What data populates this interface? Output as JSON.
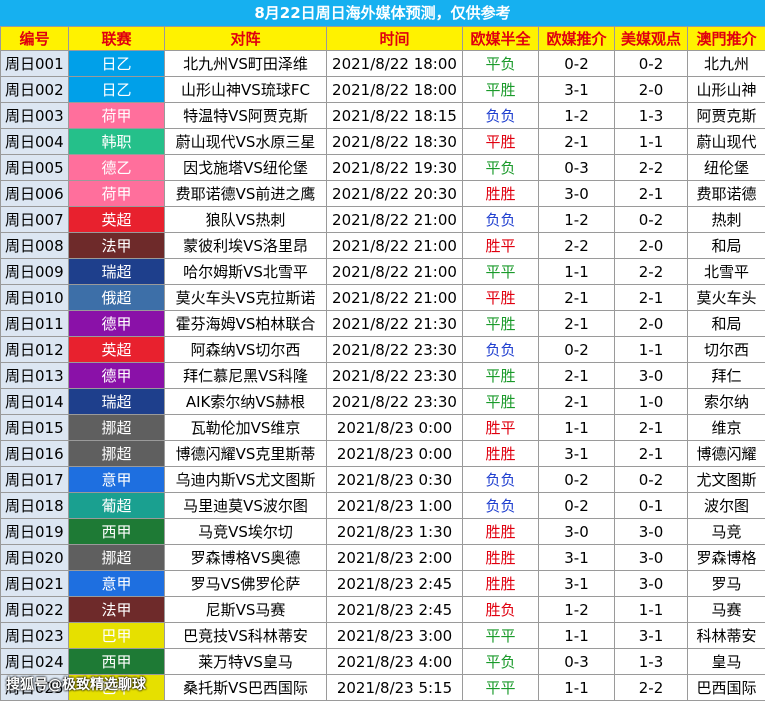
{
  "title": "8月22日周日海外媒体预测，仅供参考",
  "headers": [
    "编号",
    "联赛",
    "对阵",
    "时间",
    "欧媒半全",
    "欧媒推介",
    "美媒观点",
    "澳門推介"
  ],
  "colors": {
    "half_red": "#e0000f",
    "half_green": "#1a9a2a",
    "half_blue": "#1f3fd0"
  },
  "rows": [
    {
      "id": "周日001",
      "league": "日乙",
      "league_color": "#00a0e9",
      "match": "北九州VS町田泽维",
      "time": "2021/8/22 18:00",
      "half": "平负",
      "half_color": "#1a9a2a",
      "euro": "0-2",
      "us": "0-2",
      "macau": "北九州"
    },
    {
      "id": "周日002",
      "league": "日乙",
      "league_color": "#00a0e9",
      "match": "山形山神VS琉球FC",
      "time": "2021/8/22 18:00",
      "half": "平胜",
      "half_color": "#1a9a2a",
      "euro": "3-1",
      "us": "2-0",
      "macau": "山形山神"
    },
    {
      "id": "周日003",
      "league": "荷甲",
      "league_color": "#ff6f9c",
      "match": "特温特VS阿贾克斯",
      "time": "2021/8/22 18:15",
      "half": "负负",
      "half_color": "#1f3fd0",
      "euro": "1-2",
      "us": "1-3",
      "macau": "阿贾克斯"
    },
    {
      "id": "周日004",
      "league": "韩职",
      "league_color": "#25c08a",
      "match": "蔚山现代VS水原三星",
      "time": "2021/8/22 18:30",
      "half": "平胜",
      "half_color": "#e0000f",
      "euro": "2-1",
      "us": "1-1",
      "macau": "蔚山现代"
    },
    {
      "id": "周日005",
      "league": "德乙",
      "league_color": "#ff6f9c",
      "match": "因戈施塔VS纽伦堡",
      "time": "2021/8/22 19:30",
      "half": "平负",
      "half_color": "#1a9a2a",
      "euro": "0-3",
      "us": "2-2",
      "macau": "纽伦堡"
    },
    {
      "id": "周日006",
      "league": "荷甲",
      "league_color": "#ff6f9c",
      "match": "费耶诺德VS前进之鹰",
      "time": "2021/8/22 20:30",
      "half": "胜胜",
      "half_color": "#e0000f",
      "euro": "3-0",
      "us": "2-1",
      "macau": "费耶诺德"
    },
    {
      "id": "周日007",
      "league": "英超",
      "league_color": "#e8212e",
      "match": "狼队VS热刺",
      "time": "2021/8/22 21:00",
      "half": "负负",
      "half_color": "#1f3fd0",
      "euro": "1-2",
      "us": "0-2",
      "macau": "热刺"
    },
    {
      "id": "周日008",
      "league": "法甲",
      "league_color": "#6e2a2a",
      "match": "蒙彼利埃VS洛里昂",
      "time": "2021/8/22 21:00",
      "half": "胜平",
      "half_color": "#e0000f",
      "euro": "2-2",
      "us": "2-0",
      "macau": "和局"
    },
    {
      "id": "周日009",
      "league": "瑞超",
      "league_color": "#1e3f8c",
      "match": "哈尔姆斯VS北雪平",
      "time": "2021/8/22 21:00",
      "half": "平平",
      "half_color": "#1a9a2a",
      "euro": "1-1",
      "us": "2-2",
      "macau": "北雪平"
    },
    {
      "id": "周日010",
      "league": "俄超",
      "league_color": "#3d6fa8",
      "match": "莫火车头VS克拉斯诺",
      "time": "2021/8/22 21:00",
      "half": "平胜",
      "half_color": "#e0000f",
      "euro": "2-1",
      "us": "2-1",
      "macau": "莫火车头"
    },
    {
      "id": "周日011",
      "league": "德甲",
      "league_color": "#8a11a8",
      "match": "霍芬海姆VS柏林联合",
      "time": "2021/8/22 21:30",
      "half": "平胜",
      "half_color": "#1a9a2a",
      "euro": "2-1",
      "us": "2-0",
      "macau": "和局"
    },
    {
      "id": "周日012",
      "league": "英超",
      "league_color": "#e8212e",
      "match": "阿森纳VS切尔西",
      "time": "2021/8/22 23:30",
      "half": "负负",
      "half_color": "#1f3fd0",
      "euro": "0-2",
      "us": "1-1",
      "macau": "切尔西"
    },
    {
      "id": "周日013",
      "league": "德甲",
      "league_color": "#8a11a8",
      "match": "拜仁慕尼黑VS科隆",
      "time": "2021/8/22 23:30",
      "half": "平胜",
      "half_color": "#1a9a2a",
      "euro": "2-1",
      "us": "3-0",
      "macau": "拜仁"
    },
    {
      "id": "周日014",
      "league": "瑞超",
      "league_color": "#1e3f8c",
      "match": "AIK索尔纳VS赫根",
      "time": "2021/8/22 23:30",
      "half": "平胜",
      "half_color": "#1a9a2a",
      "euro": "2-1",
      "us": "1-0",
      "macau": "索尔纳"
    },
    {
      "id": "周日015",
      "league": "挪超",
      "league_color": "#5f5f5f",
      "match": "瓦勒伦加VS维京",
      "time": "2021/8/23 0:00",
      "half": "胜平",
      "half_color": "#e0000f",
      "euro": "1-1",
      "us": "2-1",
      "macau": "维京"
    },
    {
      "id": "周日016",
      "league": "挪超",
      "league_color": "#5f5f5f",
      "match": "博德闪耀VS克里斯蒂",
      "time": "2021/8/23 0:00",
      "half": "胜胜",
      "half_color": "#e0000f",
      "euro": "3-1",
      "us": "2-1",
      "macau": "博德闪耀"
    },
    {
      "id": "周日017",
      "league": "意甲",
      "league_color": "#1e6fe0",
      "match": "乌迪内斯VS尤文图斯",
      "time": "2021/8/23 0:30",
      "half": "负负",
      "half_color": "#1f3fd0",
      "euro": "0-2",
      "us": "0-2",
      "macau": "尤文图斯"
    },
    {
      "id": "周日018",
      "league": "葡超",
      "league_color": "#1aa090",
      "match": "马里迪莫VS波尔图",
      "time": "2021/8/23 1:00",
      "half": "负负",
      "half_color": "#1f3fd0",
      "euro": "0-2",
      "us": "0-1",
      "macau": "波尔图"
    },
    {
      "id": "周日019",
      "league": "西甲",
      "league_color": "#1e7a35",
      "match": "马竞VS埃尔切",
      "time": "2021/8/23 1:30",
      "half": "胜胜",
      "half_color": "#e0000f",
      "euro": "3-0",
      "us": "3-0",
      "macau": "马竞"
    },
    {
      "id": "周日020",
      "league": "挪超",
      "league_color": "#5f5f5f",
      "match": "罗森博格VS奥德",
      "time": "2021/8/23 2:00",
      "half": "胜胜",
      "half_color": "#e0000f",
      "euro": "3-1",
      "us": "3-0",
      "macau": "罗森博格"
    },
    {
      "id": "周日021",
      "league": "意甲",
      "league_color": "#1e6fe0",
      "match": "罗马VS佛罗伦萨",
      "time": "2021/8/23 2:45",
      "half": "胜胜",
      "half_color": "#e0000f",
      "euro": "3-1",
      "us": "3-0",
      "macau": "罗马"
    },
    {
      "id": "周日022",
      "league": "法甲",
      "league_color": "#6e2a2a",
      "match": "尼斯VS马赛",
      "time": "2021/8/23 2:45",
      "half": "胜负",
      "half_color": "#e0000f",
      "euro": "1-2",
      "us": "1-1",
      "macau": "马赛"
    },
    {
      "id": "周日023",
      "league": "巴甲",
      "league_color": "#e6e000",
      "match": "巴竞技VS科林蒂安",
      "time": "2021/8/23 3:00",
      "half": "平平",
      "half_color": "#1a9a2a",
      "euro": "1-1",
      "us": "3-1",
      "macau": "科林蒂安"
    },
    {
      "id": "周日024",
      "league": "西甲",
      "league_color": "#1e7a35",
      "match": "莱万特VS皇马",
      "time": "2021/8/23 4:00",
      "half": "平负",
      "half_color": "#1a9a2a",
      "euro": "0-3",
      "us": "1-3",
      "macau": "皇马"
    },
    {
      "id": "周日025",
      "league": "巴甲",
      "league_color": "#e6e000",
      "match": "桑托斯VS巴西国际",
      "time": "2021/8/23 5:15",
      "half": "平平",
      "half_color": "#1a9a2a",
      "euro": "1-1",
      "us": "2-2",
      "macau": "巴西国际"
    }
  ],
  "watermark": "搜狐号@极致精选聊球"
}
